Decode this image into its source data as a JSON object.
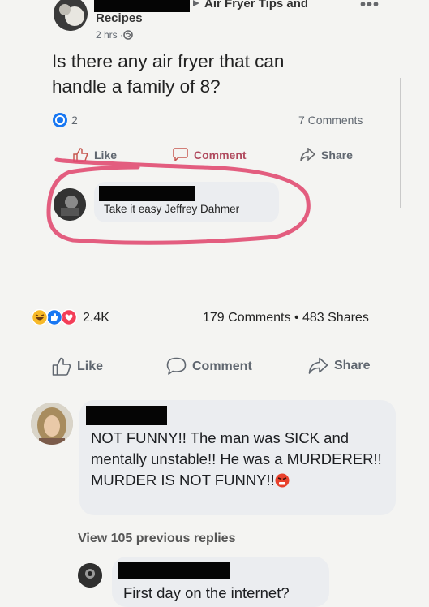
{
  "top_post": {
    "group_name": "Air Fryer Tips and",
    "author_line": "Recipes",
    "timestamp": "2 hrs · ",
    "body": "Is there any air fryer that can handle a family of 8?",
    "reaction_count": "2",
    "comments_count": "7 Comments",
    "actions": {
      "like": "Like",
      "comment": "Comment",
      "share": "Share"
    },
    "reply": {
      "text": "Take it easy Jeffrey Dahmer"
    }
  },
  "outer_post": {
    "reactions_count": "2.4K",
    "stats": "179 Comments • 483 Shares",
    "actions": {
      "like": "Like",
      "comment": "Comment",
      "share": "Share"
    }
  },
  "comments": [
    {
      "text": "NOT FUNNY!! The man was SICK and mentally unstable!! He was a MURDERER!! MURDER IS NOT FUNNY!!"
    },
    {
      "text": "First day on the internet?"
    }
  ],
  "view_replies": "View 105 previous replies",
  "colors": {
    "like_blue": "#1877f2",
    "love_red": "#f33e58",
    "haha_yellow": "#f7b928",
    "highlight_circle": "#e0486e"
  },
  "icons": [
    "more-dots-icon",
    "globe-icon",
    "like-icon",
    "comment-icon",
    "share-icon",
    "angry-emoji-icon"
  ]
}
